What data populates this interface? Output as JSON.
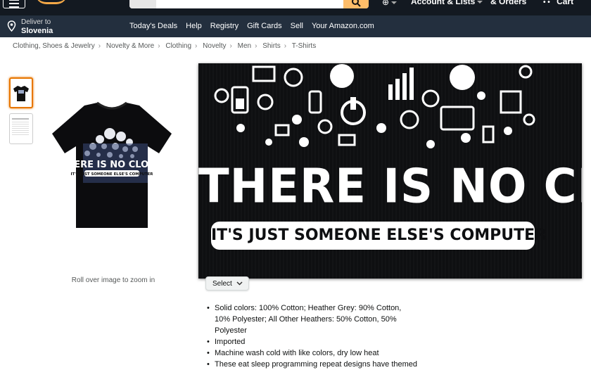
{
  "nav": {
    "account_label": "Account & Lists",
    "orders_label": "& Orders",
    "cart_label": "Cart",
    "deliver_to": "Deliver to",
    "location": "Slovenia",
    "links": [
      "Today's Deals",
      "Help",
      "Registry",
      "Gift Cards",
      "Sell",
      "Your Amazon.com"
    ]
  },
  "breadcrumb": [
    "Clothing, Shoes & Jewelry",
    "Novelty & More",
    "Clothing",
    "Novelty",
    "Men",
    "Shirts",
    "T-Shirts"
  ],
  "product": {
    "shirt_title": "THERE IS NO CLOUD",
    "shirt_subtitle": "IT'S JUST SOMEONE ELSE'S COMPUTER",
    "zoom_hint": "Roll over image to zoom in",
    "size_select_label": "Select",
    "bullets": [
      "Solid colors: 100% Cotton; Heather Grey: 90% Cotton, 10% Polyester; All Other Heathers: 50% Cotton, 50% Polyester",
      "Imported",
      "Machine wash cold with like colors, dry low heat",
      "These eat sleep programming repeat designs have themed"
    ]
  },
  "colors": {
    "nav_top": "#131921",
    "nav_main": "#232f3e",
    "accent_orange": "#febd69",
    "thumb_active": "#e77600"
  }
}
